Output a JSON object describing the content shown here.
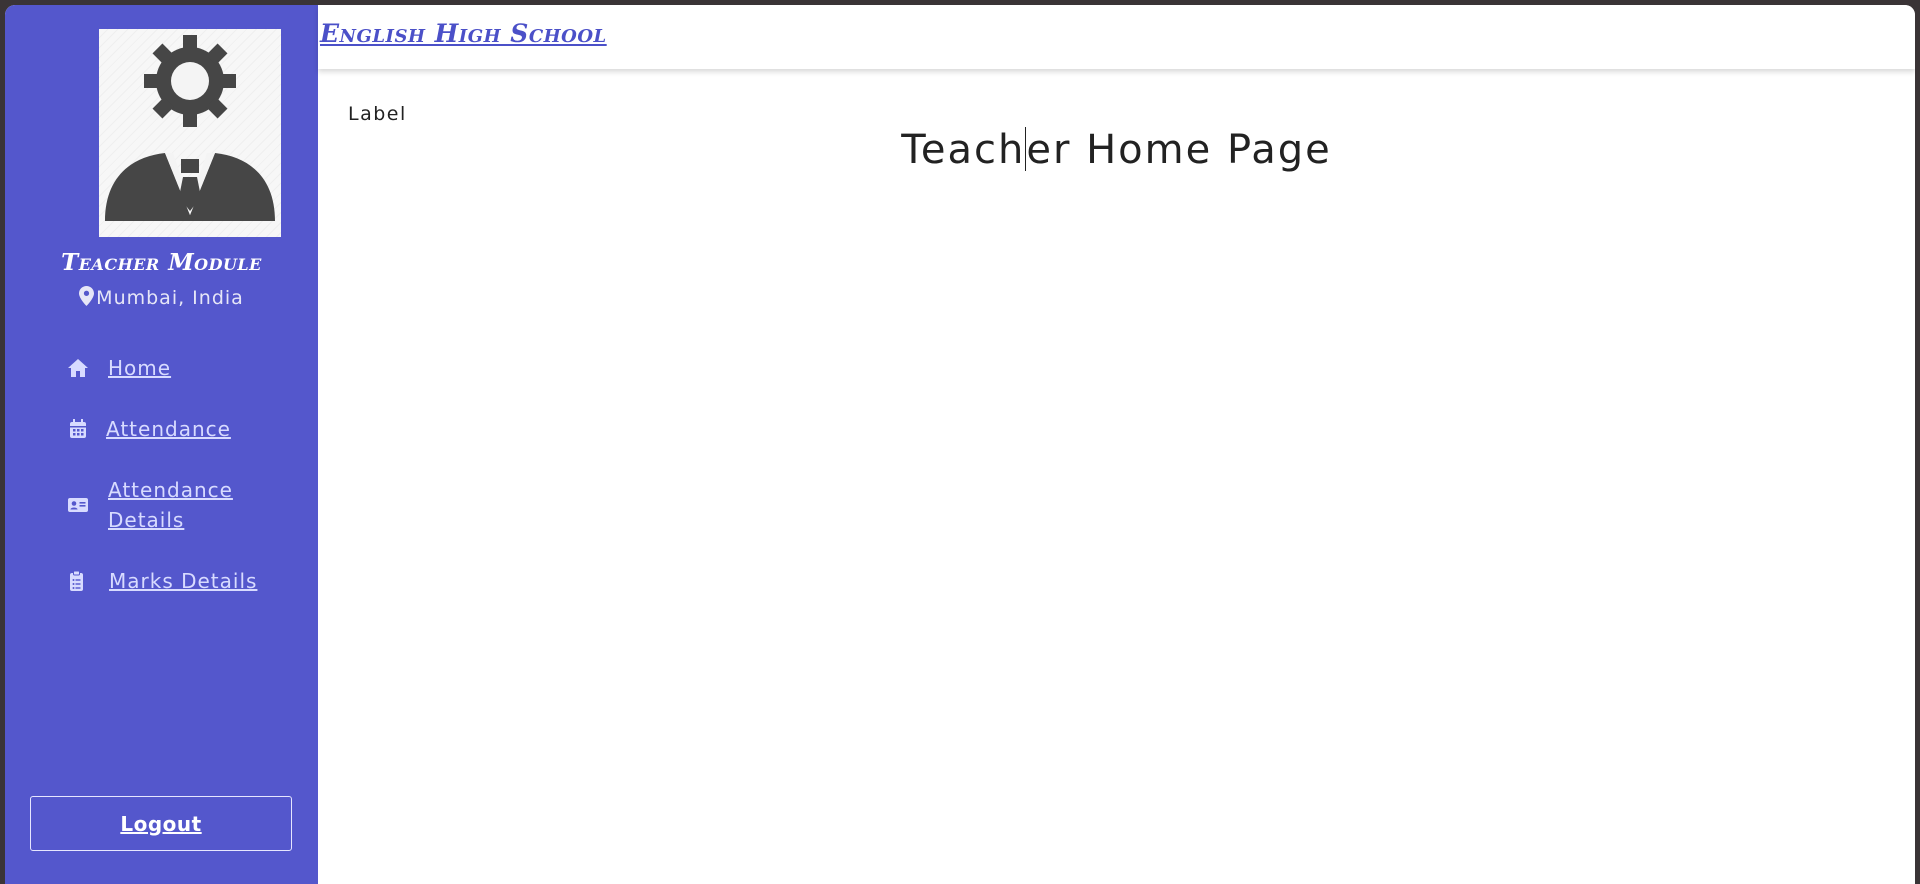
{
  "sidebar": {
    "module_title": "Teacher Module",
    "location": "Mumbai, India",
    "items": [
      {
        "label": "Home",
        "icon": "home-icon"
      },
      {
        "label": "Attendance",
        "icon": "calendar-icon"
      },
      {
        "label": "Attendance Details",
        "icon": "id-card-icon"
      },
      {
        "label": "Marks Details",
        "icon": "clipboard-list-icon"
      }
    ],
    "logout_label": "Logout"
  },
  "header": {
    "school_name": "English High School"
  },
  "main": {
    "label": "Label",
    "heading_part1": "Teach",
    "heading_part2": "er Home Page"
  },
  "colors": {
    "sidebar_bg": "#5457cc",
    "school_name": "#4b50c8",
    "nav_text": "#d8dbff"
  }
}
